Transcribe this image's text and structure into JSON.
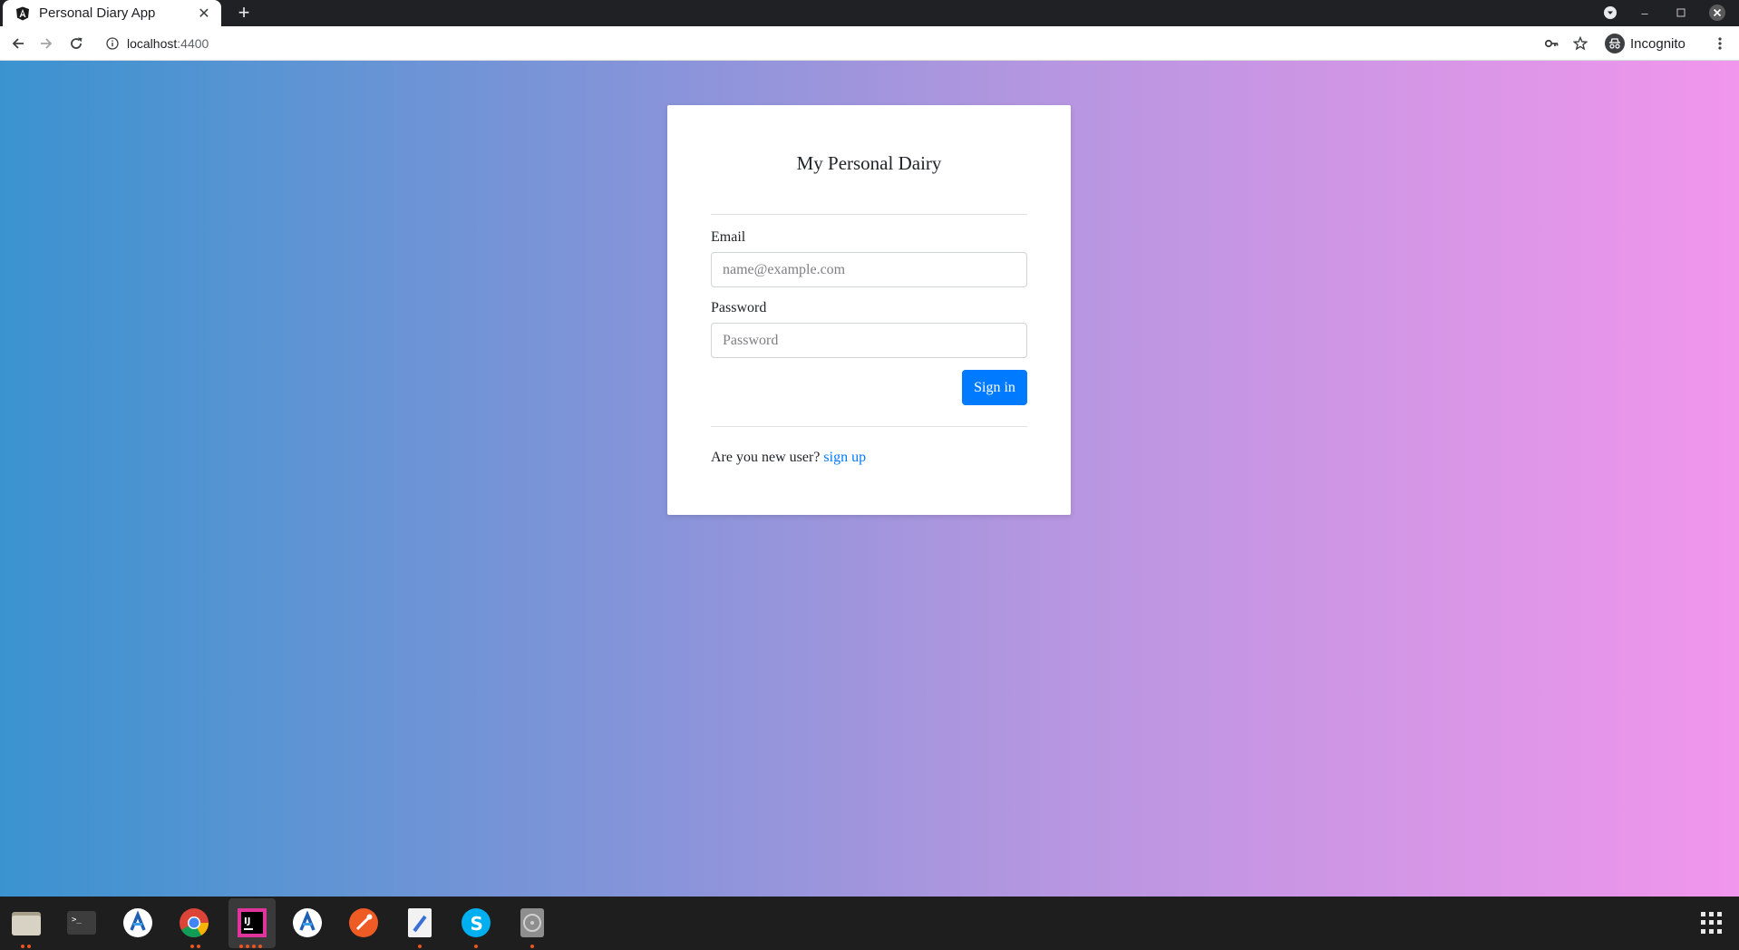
{
  "browser": {
    "tab_title": "Personal Diary App",
    "url_host": "localhost",
    "url_port": ":4400",
    "incognito_label": "Incognito"
  },
  "card": {
    "title": "My Personal Dairy",
    "email_label": "Email",
    "email_placeholder": "name@example.com",
    "password_label": "Password",
    "password_placeholder": "Password",
    "signin_label": "Sign in",
    "new_user_text": "Are you new user?",
    "signup_link": "sign up"
  },
  "colors": {
    "accent": "#007bff",
    "gradient_start": "#3a93cf",
    "gradient_end": "#f196ec"
  },
  "taskbar": {
    "apps": [
      "files-icon",
      "terminal-icon",
      "android-studio-icon",
      "chrome-icon",
      "intellij-icon",
      "android-studio-icon",
      "postman-icon",
      "text-editor-icon",
      "skype-icon",
      "disks-icon"
    ]
  }
}
